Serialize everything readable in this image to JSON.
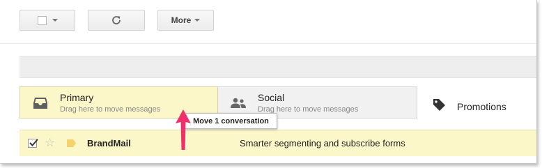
{
  "toolbar": {
    "more_label": "More"
  },
  "tabs": [
    {
      "title": "Primary",
      "subtitle": "Drag here to move messages",
      "icon": "inbox-icon"
    },
    {
      "title": "Social",
      "subtitle": "Drag here to move messages",
      "icon": "people-icon"
    },
    {
      "title": "Promotions",
      "icon": "tag-icon"
    }
  ],
  "tooltip": {
    "text": "Move 1 conversation"
  },
  "rows": [
    {
      "sender": "BrandMail",
      "subject": "Smarter segmenting and subscribe forms",
      "checked": true,
      "starred": false
    }
  ],
  "colors": {
    "primary_tab": "#fcf7c8",
    "selected_row": "#fcf7c8",
    "arrow": "#f0306a",
    "label_tag": "#f5d36a"
  }
}
